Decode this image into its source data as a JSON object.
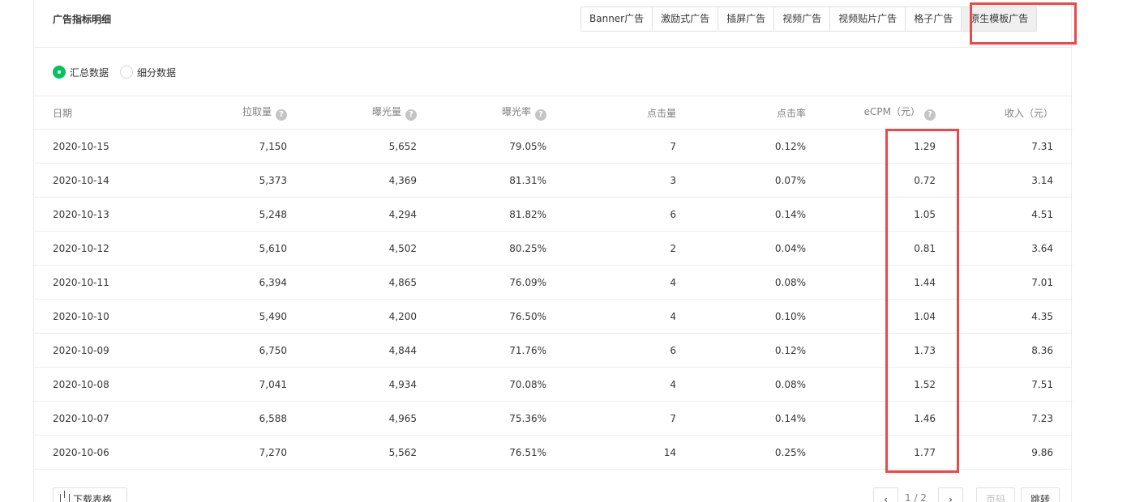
{
  "card": {
    "title": "广告指标明细"
  },
  "tabs": [
    {
      "label": "Banner广告",
      "active": false
    },
    {
      "label": "激励式广告",
      "active": false
    },
    {
      "label": "插屏广告",
      "active": false
    },
    {
      "label": "视频广告",
      "active": false
    },
    {
      "label": "视频贴片广告",
      "active": false
    },
    {
      "label": "格子广告",
      "active": false
    },
    {
      "label": "原生模板广告",
      "active": true
    }
  ],
  "view_mode": {
    "options": [
      {
        "label": "汇总数据",
        "checked": true
      },
      {
        "label": "细分数据",
        "checked": false
      }
    ]
  },
  "table": {
    "headers": [
      "日期",
      "拉取量",
      "曝光量",
      "曝光率",
      "点击量",
      "点击率",
      "eCPM（元）",
      "收入（元）"
    ],
    "help_icon_columns": [
      1,
      2,
      3,
      6
    ],
    "help_icon_glyph": "?",
    "rows": [
      [
        "2020-10-15",
        "7,150",
        "5,652",
        "79.05%",
        "7",
        "0.12%",
        "1.29",
        "7.31"
      ],
      [
        "2020-10-14",
        "5,373",
        "4,369",
        "81.31%",
        "3",
        "0.07%",
        "0.72",
        "3.14"
      ],
      [
        "2020-10-13",
        "5,248",
        "4,294",
        "81.82%",
        "6",
        "0.14%",
        "1.05",
        "4.51"
      ],
      [
        "2020-10-12",
        "5,610",
        "4,502",
        "80.25%",
        "2",
        "0.04%",
        "0.81",
        "3.64"
      ],
      [
        "2020-10-11",
        "6,394",
        "4,865",
        "76.09%",
        "4",
        "0.08%",
        "1.44",
        "7.01"
      ],
      [
        "2020-10-10",
        "5,490",
        "4,200",
        "76.50%",
        "4",
        "0.10%",
        "1.04",
        "4.35"
      ],
      [
        "2020-10-09",
        "6,750",
        "4,844",
        "71.76%",
        "6",
        "0.12%",
        "1.73",
        "8.36"
      ],
      [
        "2020-10-08",
        "7,041",
        "4,934",
        "70.08%",
        "4",
        "0.08%",
        "1.52",
        "7.51"
      ],
      [
        "2020-10-07",
        "6,588",
        "4,965",
        "75.36%",
        "7",
        "0.14%",
        "1.46",
        "7.23"
      ],
      [
        "2020-10-06",
        "7,270",
        "5,562",
        "76.51%",
        "14",
        "0.25%",
        "1.77",
        "9.86"
      ]
    ]
  },
  "footer": {
    "download_label": "下载表格",
    "prev_label": "‹",
    "next_label": "›",
    "page_indicator": "1 / 2",
    "page_input_placeholder": "页码",
    "jump_label": "跳转"
  },
  "colors": {
    "accent": "#07c160",
    "highlight": "#e84a4a",
    "border": "#ececec"
  }
}
